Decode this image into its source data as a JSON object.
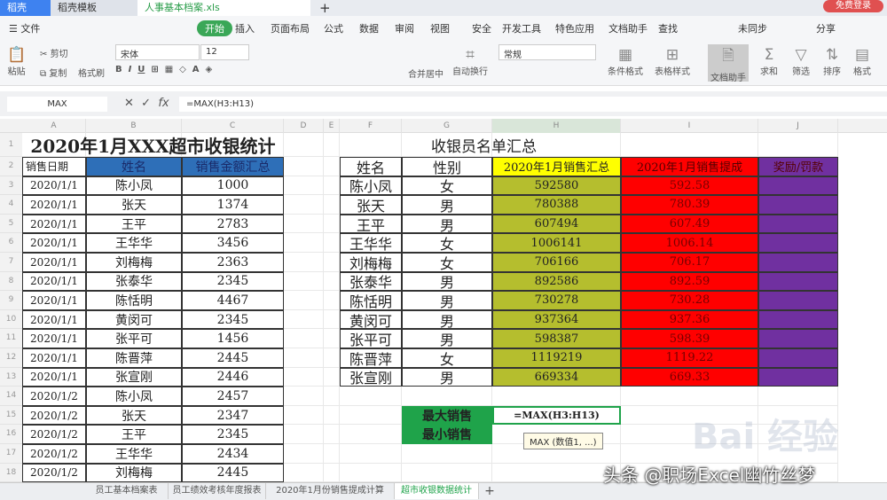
{
  "window": {
    "tabs": [
      "稻壳",
      "稻壳模板",
      "人事基本档案.xls"
    ],
    "new_tab": "+",
    "login": "免费登录"
  },
  "menu": {
    "file": "文件",
    "items": [
      "开始",
      "插入",
      "页面布局",
      "公式",
      "数据",
      "审阅",
      "视图",
      "安全",
      "开发工具",
      "特色应用",
      "文档助手",
      "查找"
    ],
    "right": [
      "未同步",
      "分享"
    ]
  },
  "ribbon": {
    "paste": "粘贴",
    "cut": "剪切",
    "copy": "复制",
    "format_painter": "格式刷",
    "font": "宋体",
    "size": "12",
    "merge": "合并居中",
    "wrap": "自动换行",
    "numfmt": "常规",
    "cond_fmt": "条件格式",
    "table_style": "表格样式",
    "doc_assistant": "文档助手",
    "sum": "求和",
    "filter": "筛选",
    "sort": "排序",
    "format": "格式"
  },
  "formula_bar": {
    "name_box": "MAX",
    "formula": "=MAX(H3:H13)"
  },
  "columns": [
    "A",
    "B",
    "C",
    "D",
    "E",
    "F",
    "G",
    "H",
    "I",
    "J"
  ],
  "left_table": {
    "title": "2020年1月XXX超市收银统计",
    "headers": [
      "销售日期",
      "姓名",
      "销售金额汇总"
    ],
    "rows": [
      [
        "2020/1/1",
        "陈小凤",
        "1000"
      ],
      [
        "2020/1/1",
        "张天",
        "1374"
      ],
      [
        "2020/1/1",
        "王平",
        "2783"
      ],
      [
        "2020/1/1",
        "王华华",
        "3456"
      ],
      [
        "2020/1/1",
        "刘梅梅",
        "2363"
      ],
      [
        "2020/1/1",
        "张泰华",
        "2345"
      ],
      [
        "2020/1/1",
        "陈恬明",
        "4467"
      ],
      [
        "2020/1/1",
        "黄闵可",
        "2345"
      ],
      [
        "2020/1/1",
        "张平可",
        "1456"
      ],
      [
        "2020/1/1",
        "陈晋萍",
        "2445"
      ],
      [
        "2020/1/1",
        "张宣刚",
        "2446"
      ],
      [
        "2020/1/2",
        "陈小凤",
        "2457"
      ],
      [
        "2020/1/2",
        "张天",
        "2347"
      ],
      [
        "2020/1/2",
        "王平",
        "2345"
      ],
      [
        "2020/1/2",
        "王华华",
        "2434"
      ],
      [
        "2020/1/2",
        "刘梅梅",
        "2445"
      ]
    ]
  },
  "right_table": {
    "title": "收银员名单汇总",
    "headers": [
      "姓名",
      "性别",
      "2020年1月销售汇总",
      "2020年1月销售提成",
      "奖励/罚款"
    ],
    "rows": [
      [
        "陈小凤",
        "女",
        "592580",
        "592.58",
        ""
      ],
      [
        "张天",
        "男",
        "780388",
        "780.39",
        ""
      ],
      [
        "王平",
        "男",
        "607494",
        "607.49",
        ""
      ],
      [
        "王华华",
        "女",
        "1006141",
        "1006.14",
        ""
      ],
      [
        "刘梅梅",
        "女",
        "706166",
        "706.17",
        ""
      ],
      [
        "张泰华",
        "男",
        "892586",
        "892.59",
        ""
      ],
      [
        "陈恬明",
        "男",
        "730278",
        "730.28",
        ""
      ],
      [
        "黄闵可",
        "男",
        "937364",
        "937.36",
        ""
      ],
      [
        "张平可",
        "男",
        "598387",
        "598.39",
        ""
      ],
      [
        "陈晋萍",
        "女",
        "1119219",
        "1119.22",
        ""
      ],
      [
        "张宣刚",
        "男",
        "669334",
        "669.33",
        ""
      ]
    ]
  },
  "stats": {
    "max_label": "最大销售",
    "min_label": "最小销售",
    "editing": "=MAX(H3:H13)",
    "tooltip": "MAX (数值1, ...)"
  },
  "sheet_tabs": [
    "员工基本档案表",
    "员工绩效考核年度报表",
    "2020年1月份销售提成计算",
    "超市收银数据统计"
  ],
  "add_sheet": "+",
  "watermark": "头条 @职场Excel幽竹丝梦",
  "baidu_watermark": "Bai 经验",
  "colors": {
    "blue": "#2e6fb8",
    "yellow": "#ffff00",
    "olive": "#b5be2e",
    "red": "#ff0000",
    "purple": "#7030a0",
    "green": "#1fa34a"
  }
}
